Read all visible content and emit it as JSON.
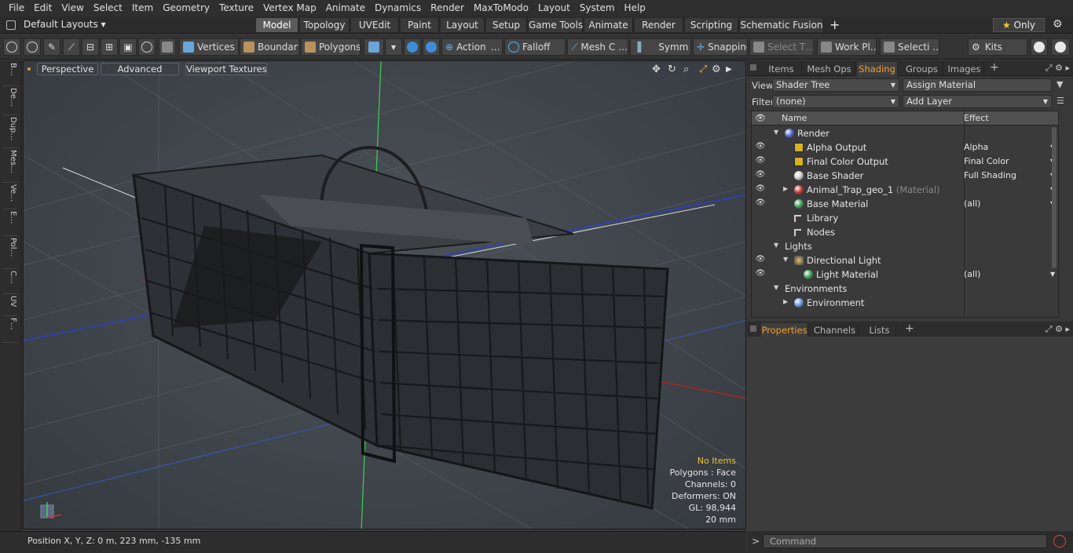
{
  "menu": [
    "File",
    "Edit",
    "View",
    "Select",
    "Item",
    "Geometry",
    "Texture",
    "Vertex Map",
    "Animate",
    "Dynamics",
    "Render",
    "MaxToModo",
    "Layout",
    "System",
    "Help"
  ],
  "layout_bar": {
    "default_layouts": "Default Layouts ▾",
    "tabs": [
      "Model",
      "Topology",
      "UVEdit",
      "Paint",
      "Layout",
      "Setup",
      "Game Tools",
      "Animate",
      "Render",
      "Scripting",
      "Schematic Fusion"
    ],
    "active_tab": "Model",
    "add": "+",
    "only_star": "★",
    "only_label": "Only"
  },
  "toolbar": {
    "vertices": "Vertices",
    "boundary": "Boundary",
    "polygons": "Polygons",
    "action": "Action",
    "action_more": "…",
    "falloff": "Falloff",
    "mesh": "Mesh C …",
    "symm": "Symm …",
    "snapping": "Snapping",
    "select_t": "Select T…",
    "work_pl": "Work Pl…",
    "selecti": "Selecti …",
    "kits": "Kits"
  },
  "left_tabs": [
    "B…",
    "De…",
    "Dup…",
    "Mes…",
    "Ve…",
    "E…",
    "Pol…",
    "C…",
    "UV",
    "F…"
  ],
  "viewport": {
    "perspective": "Perspective",
    "advanced": "Advanced",
    "viewport_textures": "Viewport Textures",
    "stats": {
      "items": "No Items",
      "polygons": "Polygons : Face",
      "channels": "Channels: 0",
      "deformers": "Deformers: ON",
      "gl": "GL: 98,944",
      "size": "20 mm"
    }
  },
  "status": {
    "position": "Position X, Y, Z:   0 m, 223 mm, -135 mm"
  },
  "panel_top": {
    "tabs": [
      "Items",
      "Mesh Ops",
      "Shading",
      "Groups",
      "Images"
    ],
    "active": "Shading",
    "plus": "+",
    "view_label": "View",
    "view_value": "Shader Tree",
    "assign_material": "Assign Material",
    "filter_label": "Filter",
    "filter_value": "(none)",
    "add_layer": "Add Layer"
  },
  "tree": {
    "col_name": "Name",
    "col_effect": "Effect",
    "rows": [
      {
        "name": "Render",
        "effect": "",
        "indent": 0,
        "icon": "render-sphere-icon",
        "color": "#5a6ad8",
        "eye": false,
        "expanded": true
      },
      {
        "name": "Alpha Output",
        "effect": "Alpha",
        "indent": 1,
        "icon": "output-icon",
        "color": "#d8b020",
        "eye": true
      },
      {
        "name": "Final Color Output",
        "effect": "Final Color",
        "indent": 1,
        "icon": "output-icon",
        "color": "#d8b020",
        "eye": true
      },
      {
        "name": "Base Shader",
        "effect": "Full Shading",
        "indent": 1,
        "icon": "shader-sphere-icon",
        "color": "#d0d0d0",
        "eye": true
      },
      {
        "name": "Animal_Trap_geo_1",
        "sub": "(Material)",
        "effect": "",
        "indent": 1,
        "icon": "material-sphere-icon",
        "color": "#c84040",
        "eye": true,
        "collapsed": true
      },
      {
        "name": "Base Material",
        "effect": "(all)",
        "indent": 1,
        "icon": "material-sphere-icon",
        "color": "#4aa860",
        "eye": true
      },
      {
        "name": "Library",
        "effect": "",
        "indent": 1,
        "icon": "folder-icon",
        "color": "#d0d0d0",
        "eye": false
      },
      {
        "name": "Nodes",
        "effect": "",
        "indent": 1,
        "icon": "folder-icon",
        "color": "#d0d0d0",
        "eye": false
      },
      {
        "name": "Lights",
        "effect": "",
        "indent": 0,
        "icon": "",
        "color": "",
        "eye": false,
        "expanded": true
      },
      {
        "name": "Directional Light",
        "effect": "",
        "indent": 1,
        "icon": "light-icon",
        "color": "#e0c060",
        "eye": true,
        "expanded": true
      },
      {
        "name": "Light Material",
        "effect": "(all)",
        "indent": 2,
        "icon": "material-sphere-icon",
        "color": "#4aa860",
        "eye": true
      },
      {
        "name": "Environments",
        "effect": "",
        "indent": 0,
        "icon": "",
        "color": "",
        "eye": false,
        "expanded": true
      },
      {
        "name": "Environment",
        "effect": "",
        "indent": 1,
        "icon": "environment-icon",
        "color": "#6fa0e0",
        "eye": false,
        "collapsed": true
      }
    ]
  },
  "panel_bottom": {
    "tabs": [
      "Properties",
      "Channels",
      "Lists"
    ],
    "active": "Properties",
    "plus": "+"
  },
  "command": {
    "prompt": ">",
    "placeholder": "Command"
  }
}
